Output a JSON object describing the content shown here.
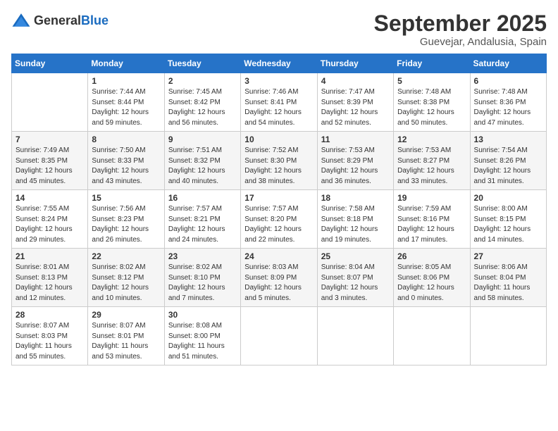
{
  "logo": {
    "general": "General",
    "blue": "Blue"
  },
  "title": "September 2025",
  "location": "Guevejar, Andalusia, Spain",
  "days_of_week": [
    "Sunday",
    "Monday",
    "Tuesday",
    "Wednesday",
    "Thursday",
    "Friday",
    "Saturday"
  ],
  "weeks": [
    [
      {
        "day": "",
        "sunrise": "",
        "sunset": "",
        "daylight": ""
      },
      {
        "day": "1",
        "sunrise": "Sunrise: 7:44 AM",
        "sunset": "Sunset: 8:44 PM",
        "daylight": "Daylight: 12 hours and 59 minutes."
      },
      {
        "day": "2",
        "sunrise": "Sunrise: 7:45 AM",
        "sunset": "Sunset: 8:42 PM",
        "daylight": "Daylight: 12 hours and 56 minutes."
      },
      {
        "day": "3",
        "sunrise": "Sunrise: 7:46 AM",
        "sunset": "Sunset: 8:41 PM",
        "daylight": "Daylight: 12 hours and 54 minutes."
      },
      {
        "day": "4",
        "sunrise": "Sunrise: 7:47 AM",
        "sunset": "Sunset: 8:39 PM",
        "daylight": "Daylight: 12 hours and 52 minutes."
      },
      {
        "day": "5",
        "sunrise": "Sunrise: 7:48 AM",
        "sunset": "Sunset: 8:38 PM",
        "daylight": "Daylight: 12 hours and 50 minutes."
      },
      {
        "day": "6",
        "sunrise": "Sunrise: 7:48 AM",
        "sunset": "Sunset: 8:36 PM",
        "daylight": "Daylight: 12 hours and 47 minutes."
      }
    ],
    [
      {
        "day": "7",
        "sunrise": "Sunrise: 7:49 AM",
        "sunset": "Sunset: 8:35 PM",
        "daylight": "Daylight: 12 hours and 45 minutes."
      },
      {
        "day": "8",
        "sunrise": "Sunrise: 7:50 AM",
        "sunset": "Sunset: 8:33 PM",
        "daylight": "Daylight: 12 hours and 43 minutes."
      },
      {
        "day": "9",
        "sunrise": "Sunrise: 7:51 AM",
        "sunset": "Sunset: 8:32 PM",
        "daylight": "Daylight: 12 hours and 40 minutes."
      },
      {
        "day": "10",
        "sunrise": "Sunrise: 7:52 AM",
        "sunset": "Sunset: 8:30 PM",
        "daylight": "Daylight: 12 hours and 38 minutes."
      },
      {
        "day": "11",
        "sunrise": "Sunrise: 7:53 AM",
        "sunset": "Sunset: 8:29 PM",
        "daylight": "Daylight: 12 hours and 36 minutes."
      },
      {
        "day": "12",
        "sunrise": "Sunrise: 7:53 AM",
        "sunset": "Sunset: 8:27 PM",
        "daylight": "Daylight: 12 hours and 33 minutes."
      },
      {
        "day": "13",
        "sunrise": "Sunrise: 7:54 AM",
        "sunset": "Sunset: 8:26 PM",
        "daylight": "Daylight: 12 hours and 31 minutes."
      }
    ],
    [
      {
        "day": "14",
        "sunrise": "Sunrise: 7:55 AM",
        "sunset": "Sunset: 8:24 PM",
        "daylight": "Daylight: 12 hours and 29 minutes."
      },
      {
        "day": "15",
        "sunrise": "Sunrise: 7:56 AM",
        "sunset": "Sunset: 8:23 PM",
        "daylight": "Daylight: 12 hours and 26 minutes."
      },
      {
        "day": "16",
        "sunrise": "Sunrise: 7:57 AM",
        "sunset": "Sunset: 8:21 PM",
        "daylight": "Daylight: 12 hours and 24 minutes."
      },
      {
        "day": "17",
        "sunrise": "Sunrise: 7:57 AM",
        "sunset": "Sunset: 8:20 PM",
        "daylight": "Daylight: 12 hours and 22 minutes."
      },
      {
        "day": "18",
        "sunrise": "Sunrise: 7:58 AM",
        "sunset": "Sunset: 8:18 PM",
        "daylight": "Daylight: 12 hours and 19 minutes."
      },
      {
        "day": "19",
        "sunrise": "Sunrise: 7:59 AM",
        "sunset": "Sunset: 8:16 PM",
        "daylight": "Daylight: 12 hours and 17 minutes."
      },
      {
        "day": "20",
        "sunrise": "Sunrise: 8:00 AM",
        "sunset": "Sunset: 8:15 PM",
        "daylight": "Daylight: 12 hours and 14 minutes."
      }
    ],
    [
      {
        "day": "21",
        "sunrise": "Sunrise: 8:01 AM",
        "sunset": "Sunset: 8:13 PM",
        "daylight": "Daylight: 12 hours and 12 minutes."
      },
      {
        "day": "22",
        "sunrise": "Sunrise: 8:02 AM",
        "sunset": "Sunset: 8:12 PM",
        "daylight": "Daylight: 12 hours and 10 minutes."
      },
      {
        "day": "23",
        "sunrise": "Sunrise: 8:02 AM",
        "sunset": "Sunset: 8:10 PM",
        "daylight": "Daylight: 12 hours and 7 minutes."
      },
      {
        "day": "24",
        "sunrise": "Sunrise: 8:03 AM",
        "sunset": "Sunset: 8:09 PM",
        "daylight": "Daylight: 12 hours and 5 minutes."
      },
      {
        "day": "25",
        "sunrise": "Sunrise: 8:04 AM",
        "sunset": "Sunset: 8:07 PM",
        "daylight": "Daylight: 12 hours and 3 minutes."
      },
      {
        "day": "26",
        "sunrise": "Sunrise: 8:05 AM",
        "sunset": "Sunset: 8:06 PM",
        "daylight": "Daylight: 12 hours and 0 minutes."
      },
      {
        "day": "27",
        "sunrise": "Sunrise: 8:06 AM",
        "sunset": "Sunset: 8:04 PM",
        "daylight": "Daylight: 11 hours and 58 minutes."
      }
    ],
    [
      {
        "day": "28",
        "sunrise": "Sunrise: 8:07 AM",
        "sunset": "Sunset: 8:03 PM",
        "daylight": "Daylight: 11 hours and 55 minutes."
      },
      {
        "day": "29",
        "sunrise": "Sunrise: 8:07 AM",
        "sunset": "Sunset: 8:01 PM",
        "daylight": "Daylight: 11 hours and 53 minutes."
      },
      {
        "day": "30",
        "sunrise": "Sunrise: 8:08 AM",
        "sunset": "Sunset: 8:00 PM",
        "daylight": "Daylight: 11 hours and 51 minutes."
      },
      {
        "day": "",
        "sunrise": "",
        "sunset": "",
        "daylight": ""
      },
      {
        "day": "",
        "sunrise": "",
        "sunset": "",
        "daylight": ""
      },
      {
        "day": "",
        "sunrise": "",
        "sunset": "",
        "daylight": ""
      },
      {
        "day": "",
        "sunrise": "",
        "sunset": "",
        "daylight": ""
      }
    ]
  ]
}
